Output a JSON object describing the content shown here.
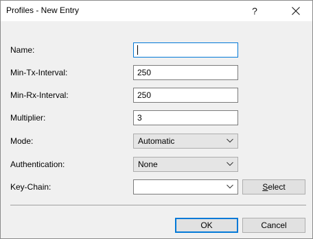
{
  "window": {
    "title": "Profiles - New Entry",
    "help_glyph": "?",
    "close_icon": "close-icon"
  },
  "fields": {
    "name": {
      "label": "Name:",
      "value": ""
    },
    "min_tx_interval": {
      "label": "Min-Tx-Interval:",
      "value": "250"
    },
    "min_rx_interval": {
      "label": "Min-Rx-Interval:",
      "value": "250"
    },
    "multiplier": {
      "label": "Multiplier:",
      "value": "3"
    },
    "mode": {
      "label": "Mode:",
      "selected": "Automatic"
    },
    "authentication": {
      "label": "Authentication:",
      "selected": "None"
    },
    "key_chain": {
      "label": "Key-Chain:",
      "value": ""
    }
  },
  "buttons": {
    "select_underlined": "S",
    "select_rest": "elect",
    "ok": "OK",
    "cancel": "Cancel"
  },
  "colors": {
    "accent": "#0078d7",
    "dialog_bg": "#f0f0f0"
  }
}
